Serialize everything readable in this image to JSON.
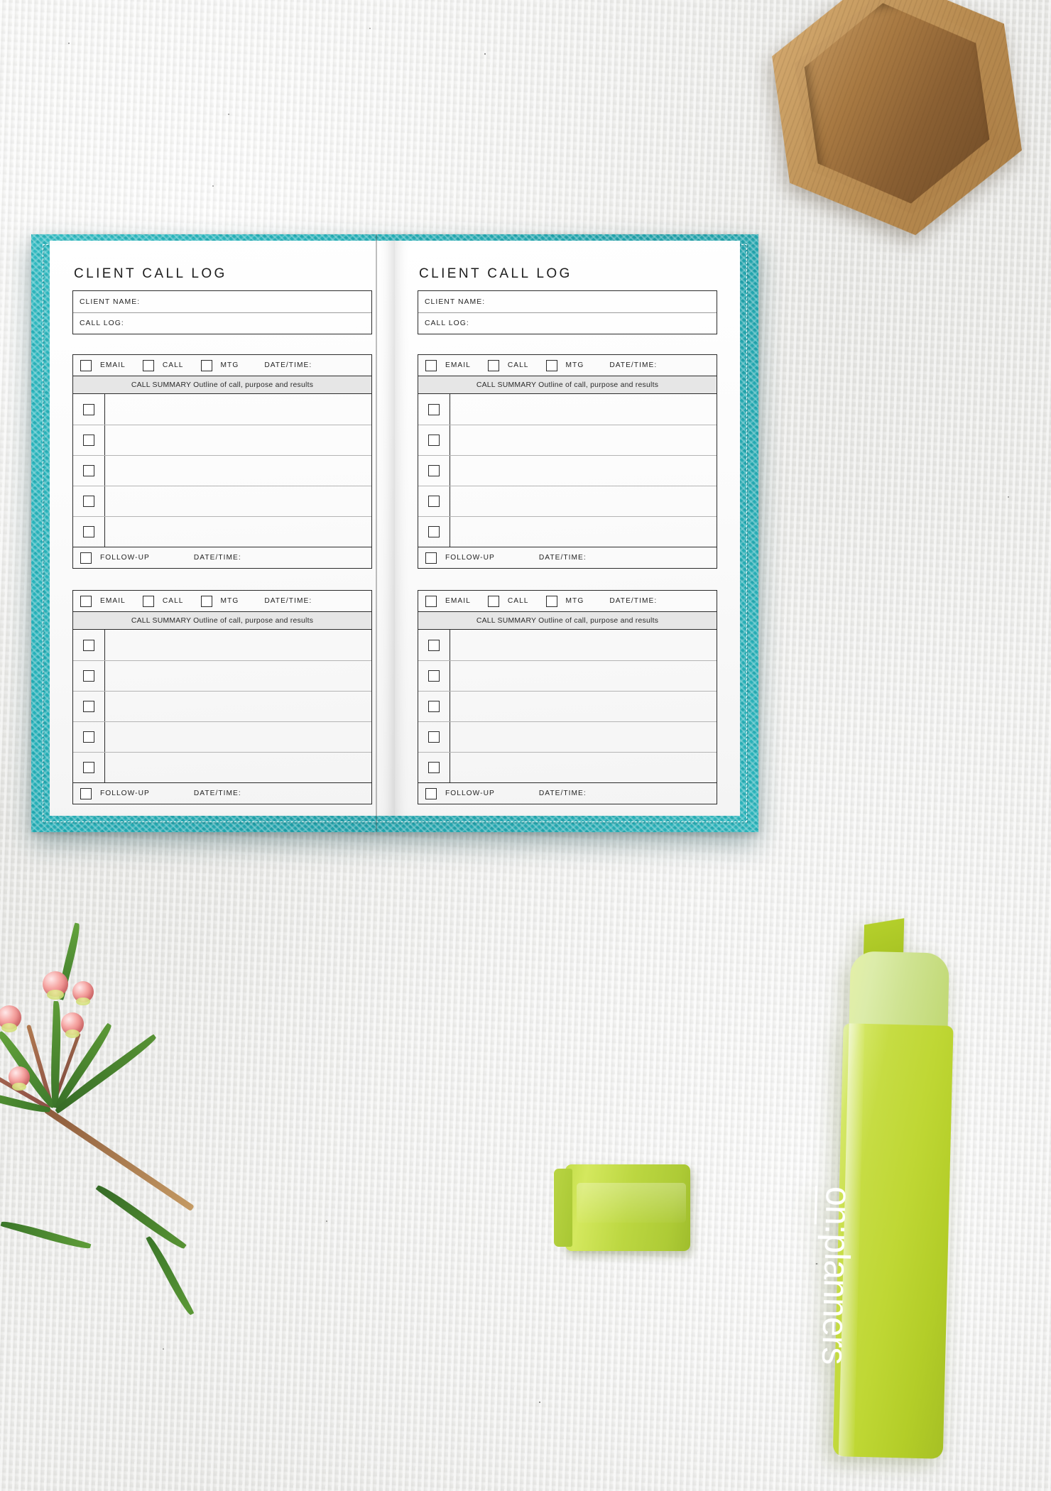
{
  "scene": {
    "background_color": "#ececeb",
    "notebook_cover_color": "#24b0b8",
    "highlighter_color": "#bfd734",
    "wood_tray_color": "#bf9358",
    "flower_color": "#e87b7c"
  },
  "objects": {
    "hex_tray_name": "wooden-hexagon-tray",
    "sprig_name": "wax-flower-sprig",
    "cap_name": "highlighter-cap",
    "marker_name": "highlighter-marker"
  },
  "brand": {
    "logo_on": "on",
    "logo_sep": ":",
    "logo_planners": "planners",
    "logo_full": "on:planners"
  },
  "labels": {
    "title": "CLIENT CALL LOG",
    "client_name": "CLIENT NAME:",
    "call_log": "CALL LOG:",
    "email": "EMAIL",
    "call": "CALL",
    "mtg": "MTG",
    "date_time": "DATE/TIME:",
    "summary": "CALL SUMMARY Outline of call, purpose and results",
    "follow_up": "FOLLOW-UP"
  },
  "pages": [
    {
      "side": "left",
      "title": "CLIENT CALL LOG",
      "header_fields": [
        {
          "label": "CLIENT NAME:",
          "value": ""
        },
        {
          "label": "CALL LOG:",
          "value": ""
        }
      ],
      "blocks": [
        {
          "options": [
            {
              "label": "EMAIL",
              "checked": false
            },
            {
              "label": "CALL",
              "checked": false
            },
            {
              "label": "MTG",
              "checked": false
            }
          ],
          "date_time_label": "DATE/TIME:",
          "date_time_value": "",
          "summary_header": "CALL SUMMARY Outline of call, purpose and results",
          "entries": [
            {
              "checked": false,
              "text": ""
            },
            {
              "checked": false,
              "text": ""
            },
            {
              "checked": false,
              "text": ""
            },
            {
              "checked": false,
              "text": ""
            },
            {
              "checked": false,
              "text": ""
            }
          ],
          "follow_up_label": "FOLLOW-UP",
          "follow_up_checked": false,
          "follow_up_date_label": "DATE/TIME:",
          "follow_up_date_value": ""
        },
        {
          "options": [
            {
              "label": "EMAIL",
              "checked": false
            },
            {
              "label": "CALL",
              "checked": false
            },
            {
              "label": "MTG",
              "checked": false
            }
          ],
          "date_time_label": "DATE/TIME:",
          "date_time_value": "",
          "summary_header": "CALL SUMMARY Outline of call, purpose and results",
          "entries": [
            {
              "checked": false,
              "text": ""
            },
            {
              "checked": false,
              "text": ""
            },
            {
              "checked": false,
              "text": ""
            },
            {
              "checked": false,
              "text": ""
            },
            {
              "checked": false,
              "text": ""
            }
          ],
          "follow_up_label": "FOLLOW-UP",
          "follow_up_checked": false,
          "follow_up_date_label": "DATE/TIME:",
          "follow_up_date_value": ""
        }
      ]
    },
    {
      "side": "right",
      "title": "CLIENT CALL LOG",
      "header_fields": [
        {
          "label": "CLIENT NAME:",
          "value": ""
        },
        {
          "label": "CALL LOG:",
          "value": ""
        }
      ],
      "blocks": [
        {
          "options": [
            {
              "label": "EMAIL",
              "checked": false
            },
            {
              "label": "CALL",
              "checked": false
            },
            {
              "label": "MTG",
              "checked": false
            }
          ],
          "date_time_label": "DATE/TIME:",
          "date_time_value": "",
          "summary_header": "CALL SUMMARY Outline of call, purpose and results",
          "entries": [
            {
              "checked": false,
              "text": ""
            },
            {
              "checked": false,
              "text": ""
            },
            {
              "checked": false,
              "text": ""
            },
            {
              "checked": false,
              "text": ""
            },
            {
              "checked": false,
              "text": ""
            }
          ],
          "follow_up_label": "FOLLOW-UP",
          "follow_up_checked": false,
          "follow_up_date_label": "DATE/TIME:",
          "follow_up_date_value": ""
        },
        {
          "options": [
            {
              "label": "EMAIL",
              "checked": false
            },
            {
              "label": "CALL",
              "checked": false
            },
            {
              "label": "MTG",
              "checked": false
            }
          ],
          "date_time_label": "DATE/TIME:",
          "date_time_value": "",
          "summary_header": "CALL SUMMARY Outline of call, purpose and results",
          "entries": [
            {
              "checked": false,
              "text": ""
            },
            {
              "checked": false,
              "text": ""
            },
            {
              "checked": false,
              "text": ""
            },
            {
              "checked": false,
              "text": ""
            },
            {
              "checked": false,
              "text": ""
            }
          ],
          "follow_up_label": "FOLLOW-UP",
          "follow_up_checked": false,
          "follow_up_date_label": "DATE/TIME:",
          "follow_up_date_value": ""
        }
      ]
    }
  ]
}
